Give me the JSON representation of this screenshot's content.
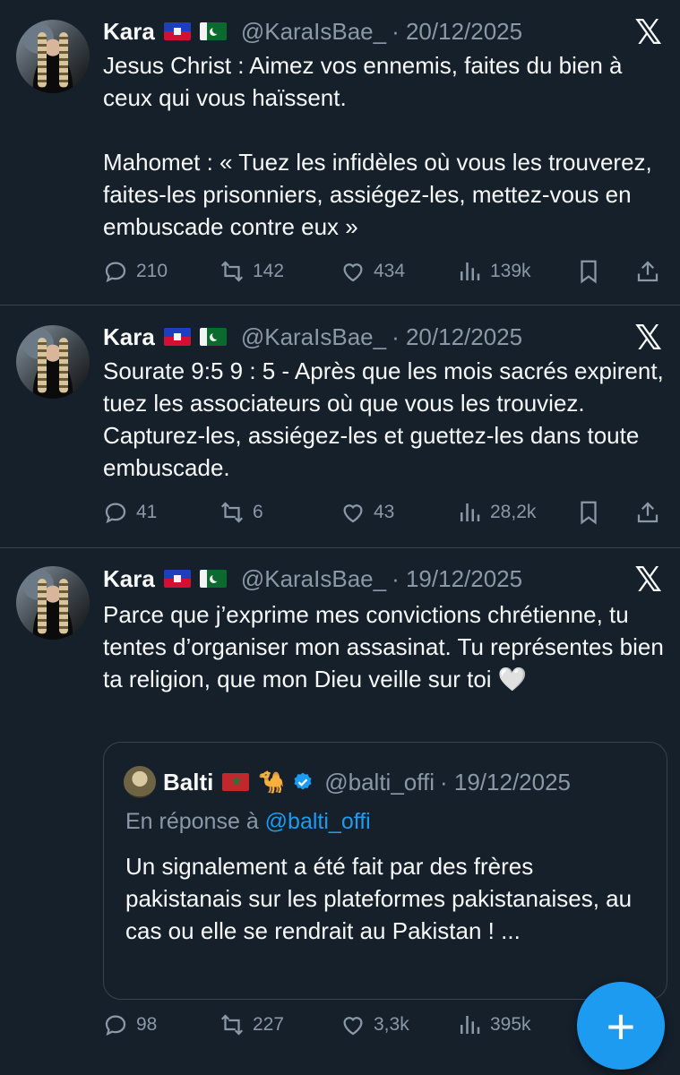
{
  "tweets": [
    {
      "name": "Kara",
      "handle": "@KaraIsBae_",
      "date": "· 20/12/2025",
      "text": "Jesus Christ : Aimez vos ennemis, faites du bien à ceux qui vous haïssent.\n\nMahomet : « Tuez les infidèles où vous les trouverez, faites-les prisonniers, assiégez-les, mettez-vous en embuscade contre eux »",
      "replies": "210",
      "reposts": "142",
      "likes": "434",
      "views": "139k"
    },
    {
      "name": "Kara",
      "handle": "@KaraIsBae_",
      "date": "· 20/12/2025",
      "text": "Sourate 9:5 9 : 5 - Après que les mois sacrés expirent, tuez les associateurs où que vous les trouviez. Capturez-les, assiégez-les et guettez-les dans toute embuscade.",
      "replies": "41",
      "reposts": "6",
      "likes": "43",
      "views": "28,2k"
    },
    {
      "name": "Kara",
      "handle": "@KaraIsBae_",
      "date": "· 19/12/2025",
      "text": "Parce que j’exprime mes convictions chrétienne, tu tentes d’organiser mon assasinat. Tu représentes bien ta religion, que mon Dieu veille sur toi 🤍",
      "replies": "98",
      "reposts": "227",
      "likes": "3,3k",
      "views": "395k"
    }
  ],
  "quote": {
    "name": "Balti",
    "handle": "@balti_offi",
    "date": "· 19/12/2025",
    "reply_prefix": "En réponse à",
    "reply_to": "@balti_offi",
    "text": "Un signalement a été fait par des frères pakistanais sur les plateformes pakistanaises, au cas ou elle se rendrait au Pakistan ! ...",
    "camel_icon": "🐪"
  },
  "x_logo": "𝕏",
  "fab_label": "+",
  "colors": {
    "background": "#15202b",
    "accent": "#1d9bf0",
    "muted": "#8b98a5",
    "divider": "#38444d"
  },
  "icons": {
    "reply": "reply-icon",
    "repost": "repost-icon",
    "like": "heart-icon",
    "views": "views-icon",
    "bookmark": "bookmark-icon",
    "share": "share-icon"
  }
}
